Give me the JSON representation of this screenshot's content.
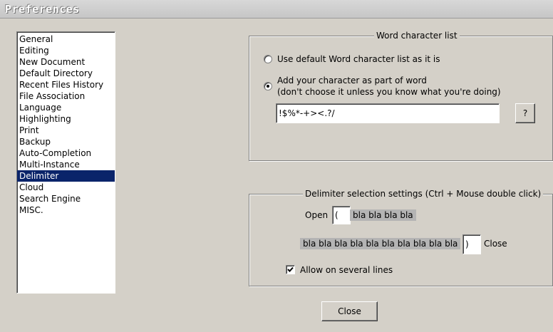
{
  "window": {
    "title": "Preferences"
  },
  "categories": {
    "items": [
      "General",
      "Editing",
      "New Document",
      "Default Directory",
      "Recent Files History",
      "File Association",
      "Language",
      "Highlighting",
      "Print",
      "Backup",
      "Auto-Completion",
      "Multi-Instance",
      "Delimiter",
      "Cloud",
      "Search Engine",
      "MISC."
    ],
    "selected": "Delimiter"
  },
  "word_char_group": {
    "title": "Word character list",
    "option_default_label": "Use default Word character list as it is",
    "option_custom_label_line1": "Add your character as part of word",
    "option_custom_label_line2": "(don't choose it unless you know what you're doing)",
    "selected_option": "custom",
    "chars_value": "!$%*-+><.?/",
    "help_label": "?"
  },
  "delimiter_group": {
    "title": "Delimiter selection settings (Ctrl + Mouse double click)",
    "open_label": "Open",
    "open_value": "(",
    "open_sample": "bla bla bla bla",
    "close_sample": "bla bla bla bla bla bla bla bla bla bla",
    "close_value": ")",
    "close_label": "Close",
    "multiline_label": "Allow on several lines",
    "multiline_checked": true
  },
  "footer": {
    "close_label": "Close"
  },
  "colors": {
    "selection": "#0a246a",
    "face": "#d4d0c8",
    "sample_bg": "#b4b4b4"
  }
}
